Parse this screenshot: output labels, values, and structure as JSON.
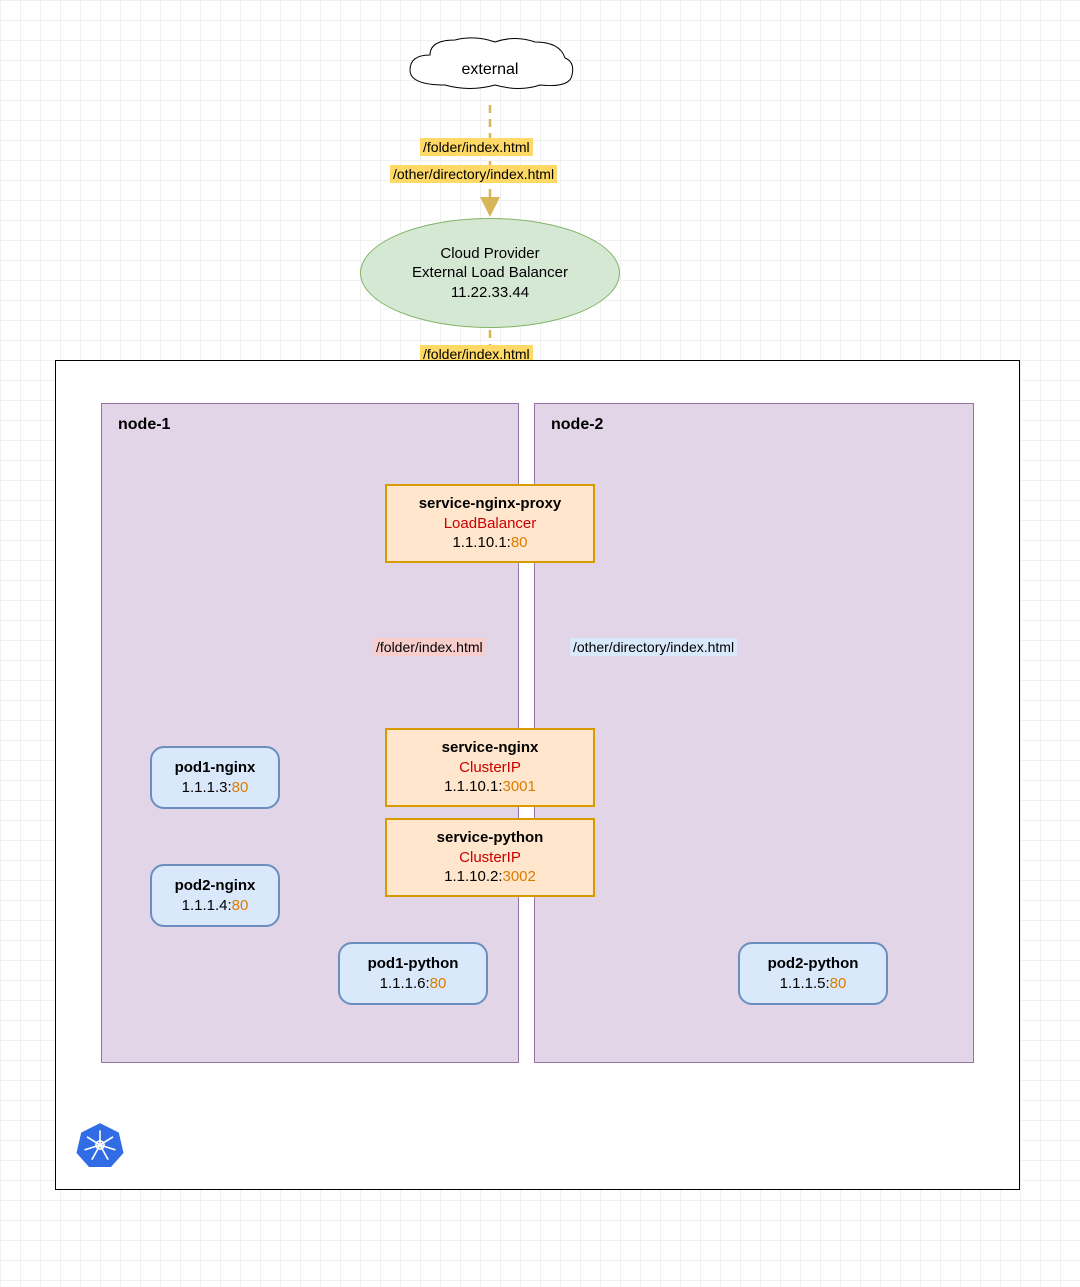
{
  "external": {
    "label": "external"
  },
  "loadBalancer": {
    "line1": "Cloud Provider",
    "line2": "External Load Balancer",
    "ip": "11.22.33.44"
  },
  "paths": {
    "folder": "/folder/index.html",
    "other": "/other/directory/index.html"
  },
  "cluster": {
    "node1": {
      "label": "node-1"
    },
    "node2": {
      "label": "node-2"
    }
  },
  "services": {
    "nginxProxy": {
      "name": "service-nginx-proxy",
      "type": "LoadBalancer",
      "ip": "1.1.10.1:",
      "port": "80"
    },
    "nginx": {
      "name": "service-nginx",
      "type": "ClusterIP",
      "ip": "1.1.10.1:",
      "port": "3001"
    },
    "python": {
      "name": "service-python",
      "type": "ClusterIP",
      "ip": "1.1.10.2:",
      "port": "3002"
    }
  },
  "pods": {
    "pod1nginx": {
      "name": "pod1-nginx",
      "ip": "1.1.1.3:",
      "port": "80"
    },
    "pod2nginx": {
      "name": "pod2-nginx",
      "ip": "1.1.1.4:",
      "port": "80"
    },
    "pod1python": {
      "name": "pod1-python",
      "ip": "1.1.1.6:",
      "port": "80"
    },
    "pod2python": {
      "name": "pod2-python",
      "ip": "1.1.1.5:",
      "port": "80"
    }
  }
}
